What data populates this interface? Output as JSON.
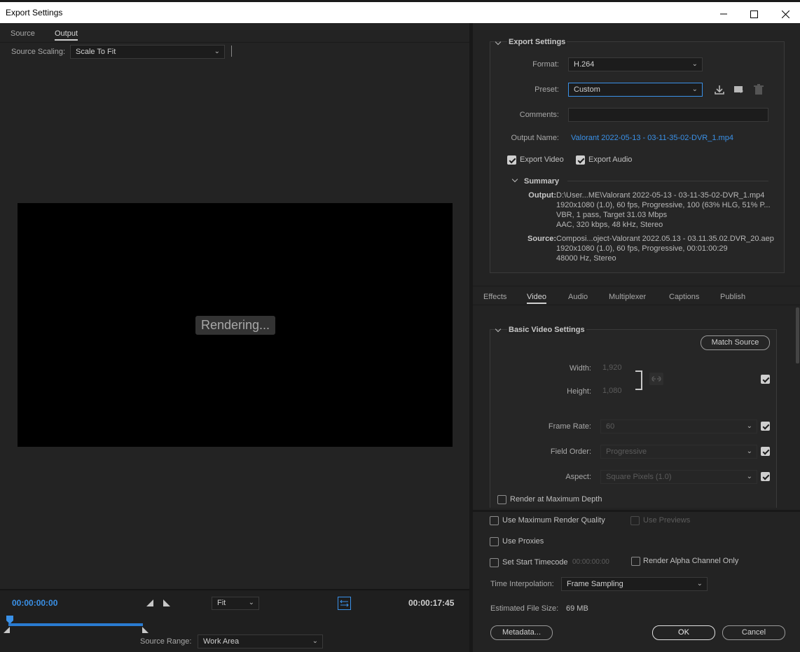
{
  "window": {
    "title": "Export Settings"
  },
  "left": {
    "tabs": [
      "Source",
      "Output"
    ],
    "source_scaling_label": "Source Scaling:",
    "source_scaling_value": "Scale To Fit",
    "rendering_text": "Rendering...",
    "timecode_current": "00:00:00:00",
    "timecode_end": "00:00:17:45",
    "zoom_value": "Fit",
    "source_range_label": "Source Range:",
    "source_range_value": "Work Area"
  },
  "export": {
    "section_title": "Export Settings",
    "format_label": "Format:",
    "format_value": "H.264",
    "preset_label": "Preset:",
    "preset_value": "Custom",
    "comments_label": "Comments:",
    "comments_value": "",
    "output_name_label": "Output Name:",
    "output_name_value": "Valorant 2022-05-13 - 03-11-35-02-DVR_1.mp4",
    "export_video_label": "Export Video",
    "export_audio_label": "Export Audio",
    "summary_title": "Summary",
    "output_label": "Output:",
    "output_lines": [
      "D:\\User...ME\\Valorant 2022-05-13 - 03-11-35-02-DVR_1.mp4",
      "1920x1080 (1.0), 60 fps, Progressive, 100 (63% HLG, 51% P...",
      "VBR, 1 pass, Target 31.03 Mbps",
      "AAC, 320 kbps, 48 kHz, Stereo"
    ],
    "source_label": "Source:",
    "source_lines": [
      "Composi...oject-Valorant 2022.05.13 - 03.11.35.02.DVR_20.aep",
      "1920x1080 (1.0), 60 fps, Progressive, 00:01:00:29",
      "48000 Hz, Stereo"
    ]
  },
  "tabs2": [
    "Effects",
    "Video",
    "Audio",
    "Multiplexer",
    "Captions",
    "Publish"
  ],
  "video": {
    "section_title": "Basic Video Settings",
    "match_source": "Match Source",
    "width_label": "Width:",
    "width_value": "1,920",
    "height_label": "Height:",
    "height_value": "1,080",
    "frame_rate_label": "Frame Rate:",
    "frame_rate_value": "60",
    "field_order_label": "Field Order:",
    "field_order_value": "Progressive",
    "aspect_label": "Aspect:",
    "aspect_value": "Square Pixels (1.0)",
    "render_max_depth": "Render at Maximum Depth"
  },
  "bottom": {
    "max_render_quality": "Use Maximum Render Quality",
    "use_previews": "Use Previews",
    "use_proxies": "Use Proxies",
    "set_start_timecode": "Set Start Timecode",
    "start_timecode_value": "00:00:00:00",
    "render_alpha": "Render Alpha Channel Only",
    "time_interp_label": "Time Interpolation:",
    "time_interp_value": "Frame Sampling",
    "est_size_label": "Estimated File Size:",
    "est_size_value": "69 MB",
    "metadata_btn": "Metadata...",
    "ok_btn": "OK",
    "cancel_btn": "Cancel"
  }
}
